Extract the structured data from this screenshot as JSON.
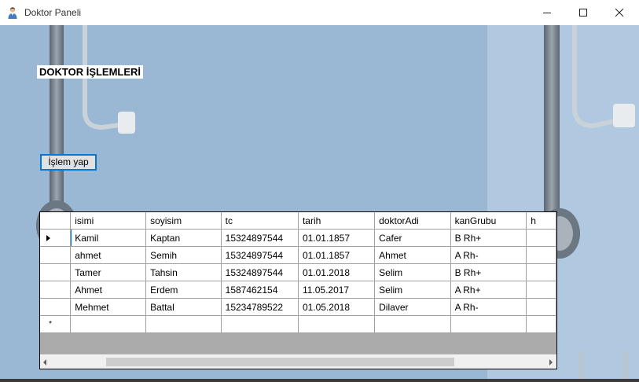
{
  "window": {
    "title": "Doktor Paneli",
    "icon": "doctor-user-icon"
  },
  "main": {
    "heading": "DOKTOR İŞLEMLERİ",
    "action_button": "İşlem yap"
  },
  "grid": {
    "columns": [
      "isimi",
      "soyisim",
      "tc",
      "tarih",
      "doktorAdi",
      "kanGrubu",
      "h"
    ],
    "rows": [
      [
        "Kamil",
        "Kaptan",
        "15324897544",
        "01.01.1857",
        "Cafer",
        "B Rh+",
        ""
      ],
      [
        "ahmet",
        "Semih",
        "15324897544",
        "01.01.1857",
        "Ahmet",
        "A Rh-",
        ""
      ],
      [
        "Tamer",
        "Tahsin",
        "15324897544",
        "01.01.2018",
        "Selim",
        "B Rh+",
        ""
      ],
      [
        "Ahmet",
        "Erdem",
        "1587462154",
        "11.05.2017",
        "Selim",
        "A Rh+",
        ""
      ],
      [
        "Mehmet",
        "Battal",
        "15234789522",
        "01.05.2018",
        "Dilaver",
        "A Rh-",
        ""
      ]
    ],
    "new_row_marker": "*"
  },
  "colors": {
    "accent": "#0078d7",
    "grid_background": "#ababab",
    "window_background": "#8fb0cf"
  }
}
